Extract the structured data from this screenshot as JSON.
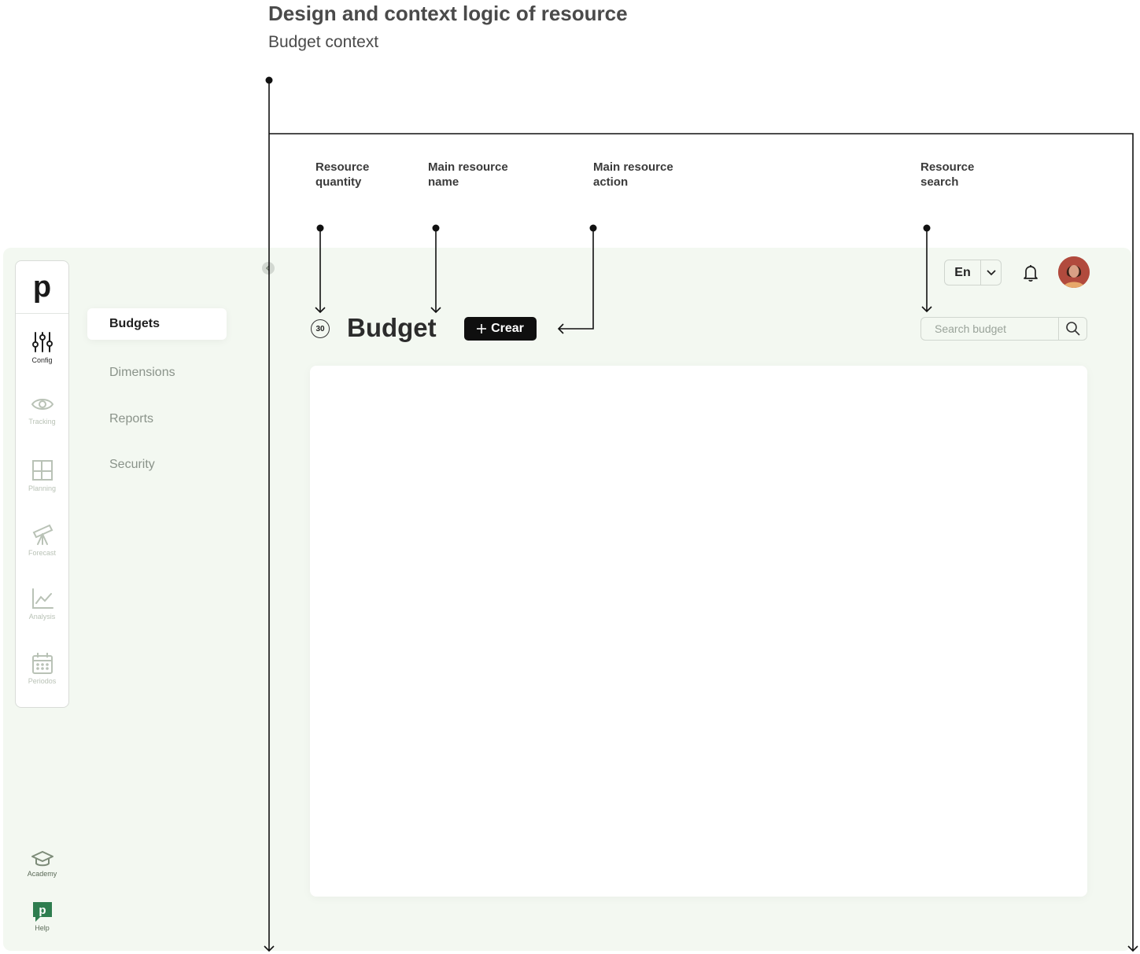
{
  "doc": {
    "title": "Design and context logic of resource",
    "subtitle": "Budget context"
  },
  "annotations": [
    {
      "label": "Resource\nquantity"
    },
    {
      "label": "Main resource\nname"
    },
    {
      "label": "Main resource\naction"
    },
    {
      "label": "Resource\nsearch"
    }
  ],
  "app": {
    "logo": "p",
    "rail": [
      {
        "label": "Config",
        "icon": "sliders-icon",
        "active": true
      },
      {
        "label": "Tracking",
        "icon": "eye-icon",
        "active": false
      },
      {
        "label": "Planning",
        "icon": "layout-icon",
        "active": false
      },
      {
        "label": "Forecast",
        "icon": "telescope-icon",
        "active": false
      },
      {
        "label": "Analysis",
        "icon": "line-chart-icon",
        "active": false
      },
      {
        "label": "Periodos",
        "icon": "calendar-icon",
        "active": false
      }
    ],
    "bottom": [
      {
        "label": "Academy",
        "icon": "graduation-cap-icon"
      },
      {
        "label": "Help",
        "icon": "help-chat-icon"
      }
    ],
    "subnav": [
      "Budgets",
      "Dimensions",
      "Reports",
      "Security"
    ],
    "header": {
      "count": "30",
      "title": "Budget",
      "create_label": "Crear",
      "search_placeholder": "Search budget",
      "language": "En"
    },
    "colors": {
      "background": "#f3f8f1",
      "primary_button": "#0f0f0f",
      "help_badge": "#2e7d4f"
    }
  }
}
